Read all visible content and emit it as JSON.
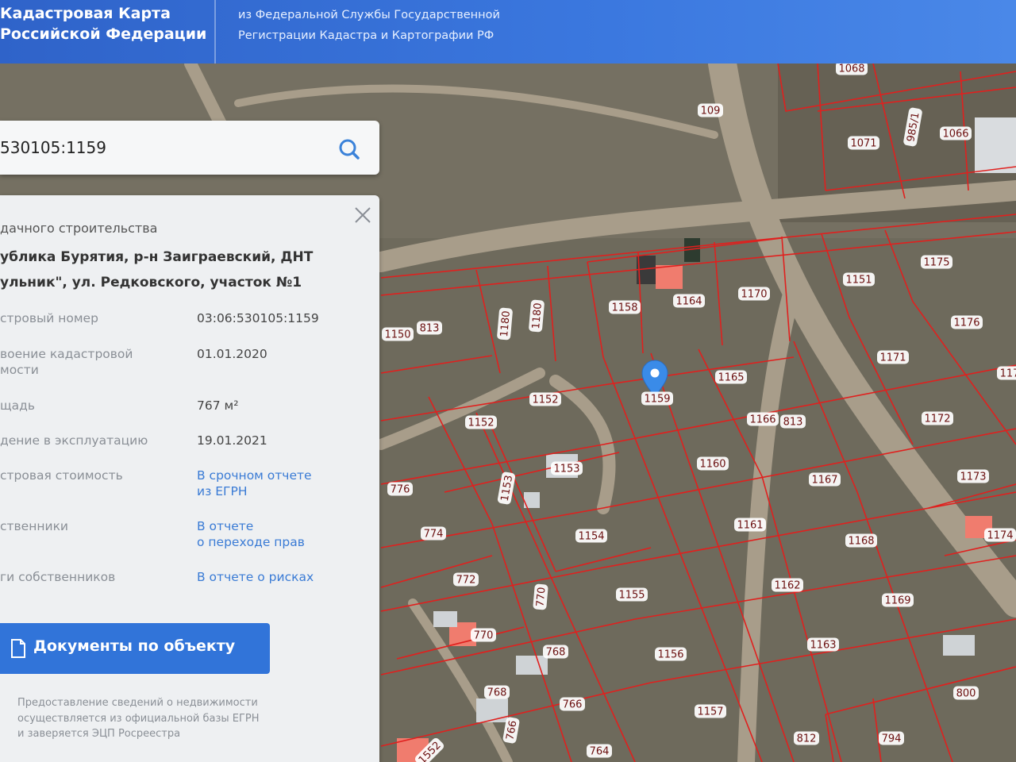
{
  "header": {
    "title_line1": "Кадастровая Карта",
    "title_line2": "Российской Федерации",
    "subtitle_line1": "из Федеральной Службы Государственной",
    "subtitle_line2": "Регистрации Кадастра и Картографии РФ"
  },
  "search": {
    "value": "530105:1159",
    "icon": "search-icon"
  },
  "panel": {
    "purpose": "дачного строительства",
    "address_line1": "ублика Бурятия, р-н Заиграевский, ДНТ",
    "address_line2": "ульник\", ул. Редковского, участок №1",
    "rows": [
      {
        "label": "стровый номер",
        "value": "03:06:530105:1159"
      },
      {
        "label": "воение кадастровой",
        "label2": "мости",
        "value": "01.01.2020"
      },
      {
        "label": "щадь",
        "value": "767 м²"
      },
      {
        "label": "дение в эксплуатацию",
        "value": "19.01.2021"
      },
      {
        "label": "стровая стоимость",
        "value": "В срочном отчете",
        "value2": "из ЕГРН"
      },
      {
        "label": "ственники",
        "value": "В отчете",
        "value2": "о переходе прав"
      },
      {
        "label": "ги собственников",
        "value": "В отчете о рисках"
      }
    ],
    "docs_button": "Документы по объекту",
    "footnote_line1": "Предоставление сведений о недвижимости",
    "footnote_line2": "осуществляется из официальной базы ЕГРН",
    "footnote_line3": "и заверяется ЭЦП Росреестра"
  },
  "map": {
    "parcel_labels": [
      "1068",
      "109",
      "985/1",
      "1066",
      "1071",
      "1175",
      "1151",
      "1170",
      "1164",
      "1158",
      "1180",
      "1180",
      "813",
      "1150",
      "1176",
      "1171",
      "1165",
      "1159",
      "1152",
      "1152",
      "1166",
      "813",
      "1172",
      "1153",
      "1153",
      "1160",
      "1167",
      "1173",
      "776",
      "774",
      "1154",
      "1161",
      "1168",
      "1174",
      "772",
      "770",
      "1155",
      "1162",
      "1169",
      "770",
      "768",
      "1156",
      "1163",
      "768",
      "766",
      "1157",
      "800",
      "766",
      "764",
      "812",
      "794",
      "1552",
      "117"
    ],
    "pin_icon": "map-pin-icon",
    "colors": {
      "boundary": "#e0201e",
      "terrain": "#6e6a5c",
      "road": "#a89d8a"
    }
  }
}
